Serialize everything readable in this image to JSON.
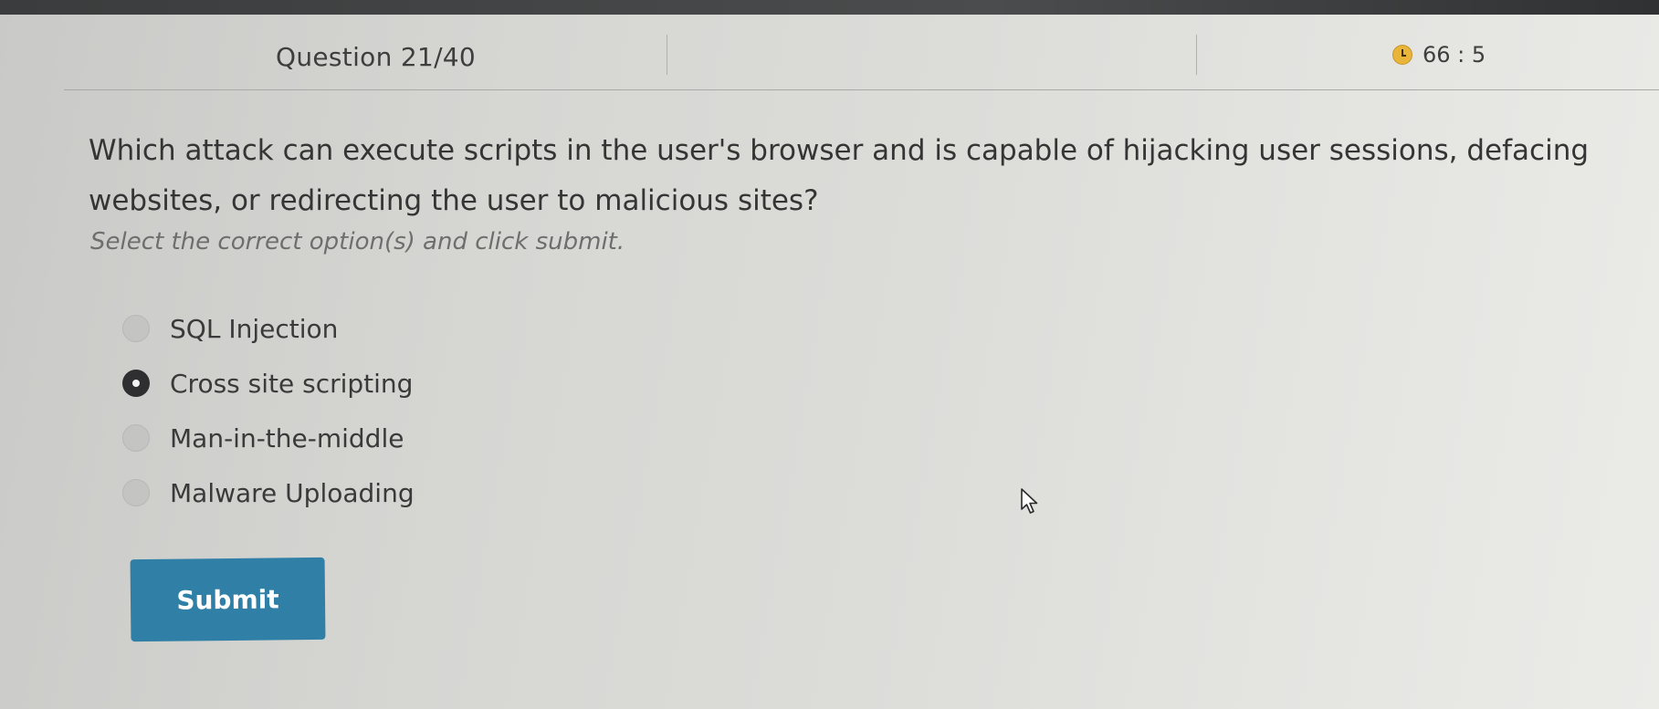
{
  "header": {
    "question_counter": "Question 21/40",
    "timer": "66 : 5"
  },
  "question": {
    "text": "Which attack can execute scripts in the user's browser and is capable of hijacking user sessions, defacing websites, or redirecting the user to malicious sites?",
    "instruction": "Select the correct option(s) and click submit."
  },
  "options": [
    {
      "label": "SQL Injection",
      "selected": false
    },
    {
      "label": "Cross site scripting",
      "selected": true
    },
    {
      "label": "Man-in-the-middle",
      "selected": false
    },
    {
      "label": "Malware Uploading",
      "selected": false
    }
  ],
  "submit": {
    "label": "Submit",
    "color": "#2f7fa6"
  },
  "icons": {
    "timer": "clock-icon",
    "pointer": "mouse-cursor-icon"
  }
}
